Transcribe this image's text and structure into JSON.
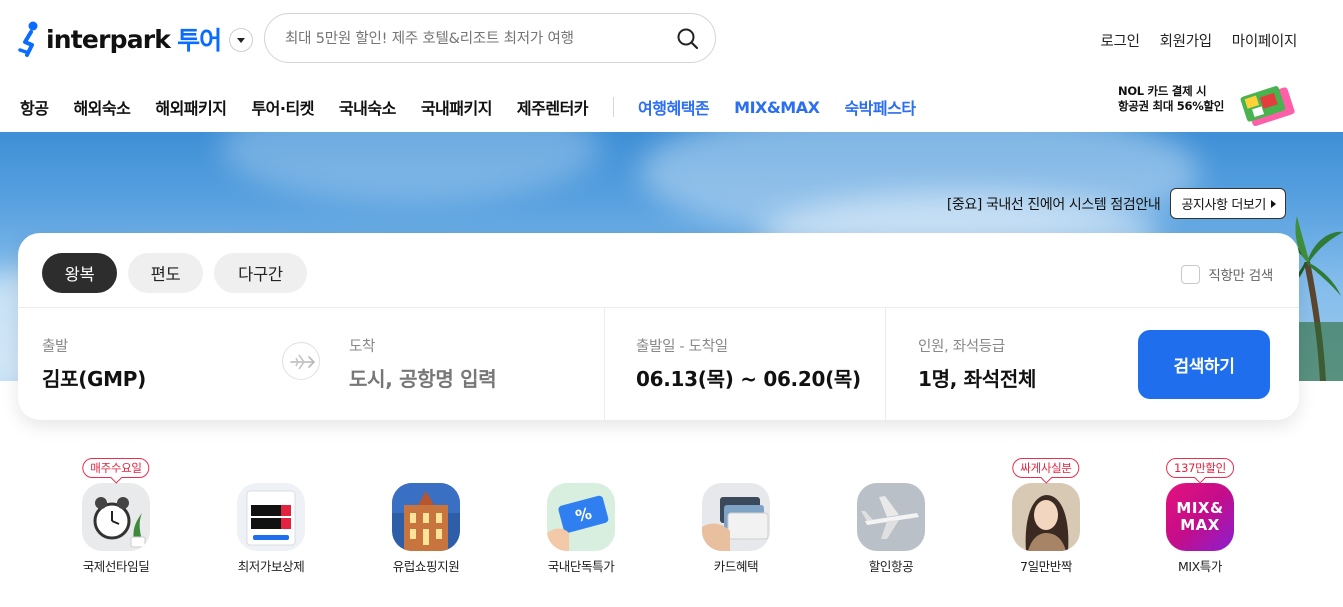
{
  "header": {
    "logo_text": "interpark",
    "logo_sub": "투어",
    "search": {
      "placeholder": "최대 5만원 할인! 제주 호텔&리조트 최저가 여행",
      "icon": "search-icon"
    },
    "util_nav": [
      "로그인",
      "회원가입",
      "마이페이지"
    ],
    "gnb": {
      "items": [
        "항공",
        "해외숙소",
        "해외패키지",
        "투어·티켓",
        "국내숙소",
        "국내패키지",
        "제주렌터카"
      ],
      "highlight_items": [
        "여행혜택존",
        "MIX&MAX",
        "숙박페스타"
      ]
    },
    "promo": {
      "line1": "NOL 카드 결제 시",
      "line2": "항공권 최대 56%할인"
    }
  },
  "hero": {
    "notice_text": "[중요] 국내선 진에어 시스템 점검안내",
    "notice_button": "공지사항 더보기"
  },
  "booking": {
    "trip_tabs": [
      "왕복",
      "편도",
      "다구간"
    ],
    "active_tab": "왕복",
    "direct_only_label": "직항만 검색",
    "departure": {
      "label": "출발",
      "value": "김포(GMP)"
    },
    "arrival": {
      "label": "도착",
      "placeholder": "도시, 공항명 입력"
    },
    "dates": {
      "label": "출발일 - 도착일",
      "value": "06.13(목) ~ 06.20(목)"
    },
    "passengers": {
      "label": "인원, 좌석등급",
      "value": "1명, 좌석전체"
    },
    "search_button": "검색하기"
  },
  "quick_menu": [
    {
      "label": "국제선타임딜",
      "badge": "매주수요일",
      "icon": "alarm-clock-icon"
    },
    {
      "label": "최저가보상제",
      "badge": "",
      "icon": "lowest-price-poster-icon"
    },
    {
      "label": "유럽쇼핑지원",
      "badge": "",
      "icon": "europe-building-icon"
    },
    {
      "label": "국내단독특가",
      "badge": "",
      "icon": "percent-ticket-icon"
    },
    {
      "label": "카드혜택",
      "badge": "",
      "icon": "credit-card-icon"
    },
    {
      "label": "할인항공",
      "badge": "",
      "icon": "airplane-icon"
    },
    {
      "label": "7일만반짝",
      "badge": "싸게사실분",
      "icon": "person-photo-icon"
    },
    {
      "label": "MIX특가",
      "badge": "137만할인",
      "icon": "mix-max-logo-icon",
      "icon_text": "MIX&MAX"
    }
  ],
  "colors": {
    "brand_blue": "#1f6eee",
    "link_blue": "#2b6ef2",
    "badge_red": "#e3223f",
    "active_tab": "#2d2d2d"
  }
}
